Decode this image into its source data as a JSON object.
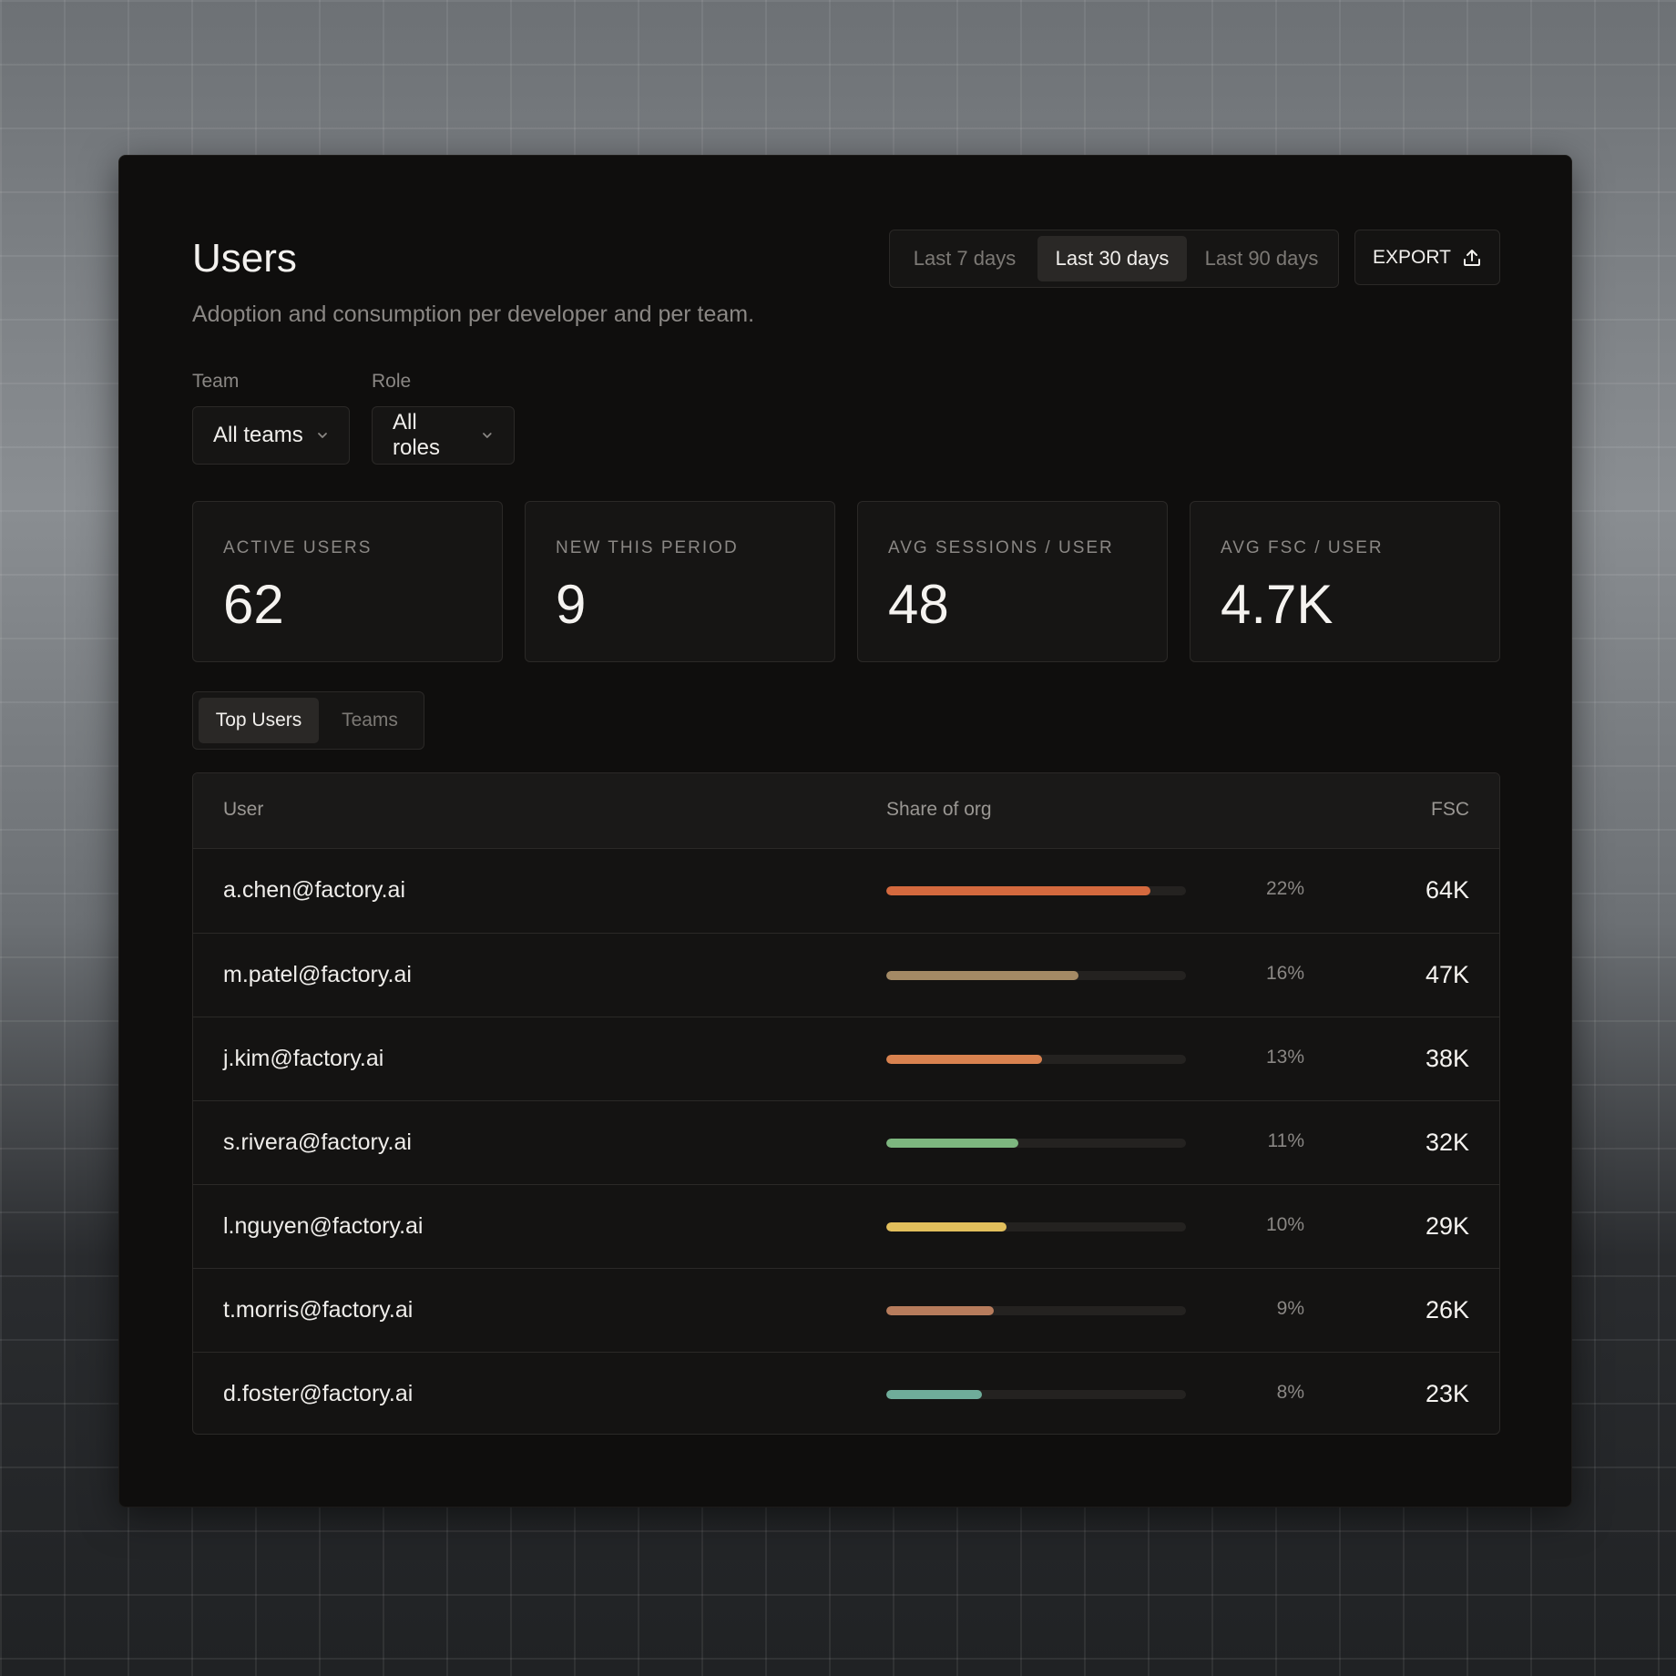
{
  "header": {
    "title": "Users",
    "subtitle": "Adoption and consumption per developer and per team."
  },
  "range": {
    "options": [
      "Last 7 days",
      "Last 30 days",
      "Last 90 days"
    ],
    "selected": "Last 30 days"
  },
  "export": {
    "label": "EXPORT",
    "icon": "upload-icon"
  },
  "filters": {
    "team": {
      "label": "Team",
      "value": "All teams"
    },
    "role": {
      "label": "Role",
      "value": "All roles"
    }
  },
  "stats": [
    {
      "label": "ACTIVE USERS",
      "value": "62"
    },
    {
      "label": "NEW THIS PERIOD",
      "value": "9"
    },
    {
      "label": "AVG SESSIONS / USER",
      "value": "48"
    },
    {
      "label": "AVG FSC / USER",
      "value": "4.7K"
    }
  ],
  "tabs": {
    "items": [
      "Top Users",
      "Teams"
    ],
    "selected": "Top Users"
  },
  "table": {
    "columns": {
      "user": "User",
      "share": "Share of org",
      "fsc": "FSC"
    },
    "rows": [
      {
        "email": "a.chen@factory.ai",
        "share": "22%",
        "fill": 0.88,
        "color": "#d4693e",
        "fsc": "64K"
      },
      {
        "email": "m.patel@factory.ai",
        "share": "16%",
        "fill": 0.64,
        "color": "#a48a65",
        "fsc": "47K"
      },
      {
        "email": "j.kim@factory.ai",
        "share": "13%",
        "fill": 0.52,
        "color": "#d9824f",
        "fsc": "38K"
      },
      {
        "email": "s.rivera@factory.ai",
        "share": "11%",
        "fill": 0.44,
        "color": "#7db67f",
        "fsc": "32K"
      },
      {
        "email": "l.nguyen@factory.ai",
        "share": "10%",
        "fill": 0.4,
        "color": "#e2bf5c",
        "fsc": "29K"
      },
      {
        "email": "t.morris@factory.ai",
        "share": "9%",
        "fill": 0.36,
        "color": "#b77c5c",
        "fsc": "26K"
      },
      {
        "email": "d.foster@factory.ai",
        "share": "8%",
        "fill": 0.32,
        "color": "#6fad9a",
        "fsc": "23K"
      }
    ]
  }
}
